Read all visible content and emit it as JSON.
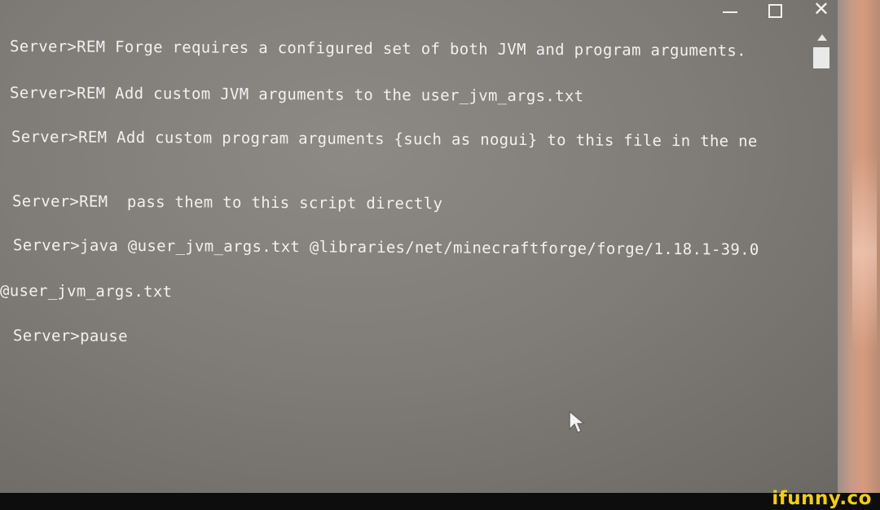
{
  "window_controls": {
    "minimize": "minimize-icon",
    "maximize": "maximize-icon",
    "close_label": "✕"
  },
  "console": {
    "lines": [
      "Server>REM Forge requires a configured set of both JVM and program arguments.",
      "Server>REM Add custom JVM arguments to the user_jvm_args.txt",
      "Server>REM Add custom program arguments {such as nogui} to this file in the ne",
      "Server>REM  pass them to this script directly",
      "Server>java @user_jvm_args.txt @libraries/net/minecraftforge/forge/1.18.1-39.0",
      "@user_jvm_args.txt",
      "Server>pause"
    ]
  },
  "watermark": "ifunny.co",
  "colors": {
    "text": "#f1f1f0",
    "background": "#807c78",
    "watermark": "#f7d000"
  }
}
